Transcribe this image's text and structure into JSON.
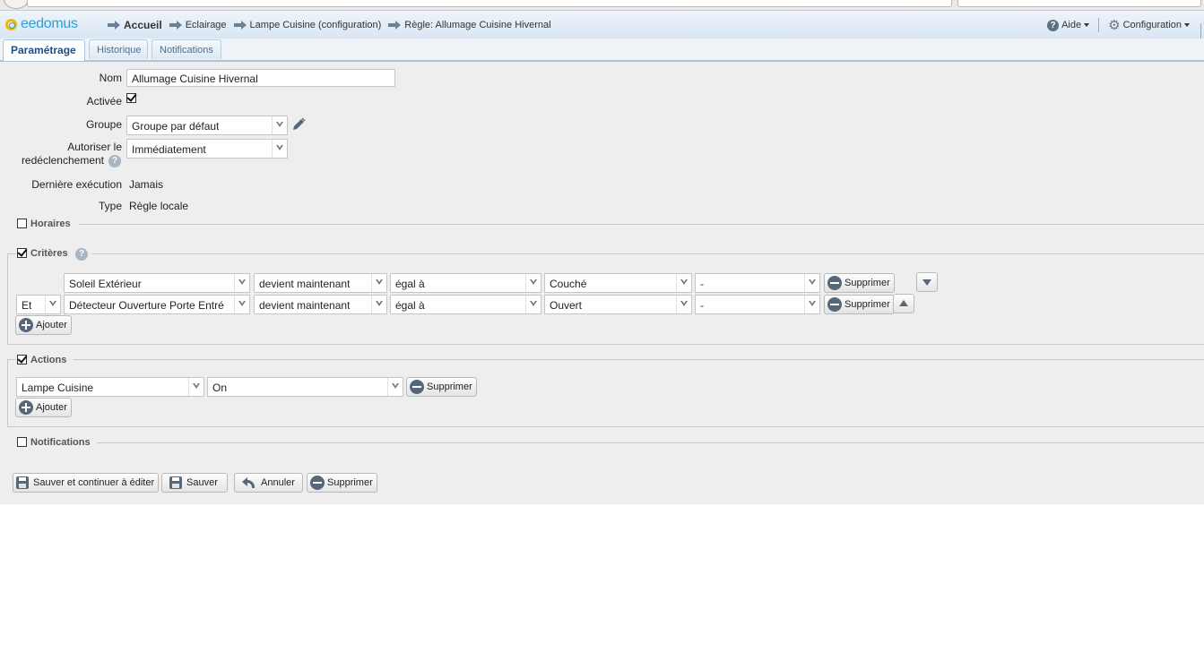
{
  "app": {
    "logo_text": "eedomus"
  },
  "breadcrumb": [
    "Accueil",
    "Eclairage",
    "Lampe Cuisine (configuration)",
    "Règle: Allumage Cuisine Hivernal"
  ],
  "topbar": {
    "help_label": "Aide",
    "config_label": "Configuration"
  },
  "tabs": [
    {
      "label": "Paramétrage",
      "active": true
    },
    {
      "label": "Historique",
      "active": false
    },
    {
      "label": "Notifications",
      "active": false
    }
  ],
  "form": {
    "name_label": "Nom",
    "name_value": "Allumage Cuisine Hivernal",
    "active_label": "Activée",
    "active_checked": true,
    "group_label": "Groupe",
    "group_value": "Groupe par défaut",
    "retrigger_label_1": "Autoriser le",
    "retrigger_label_2": "redéclenchement",
    "retrigger_value": "Immédiatement",
    "last_exec_label": "Dernière exécution",
    "last_exec_value": "Jamais",
    "type_label": "Type",
    "type_value": "Règle locale"
  },
  "sections": {
    "schedules": {
      "title": "Horaires",
      "checked": false
    },
    "criteria": {
      "title": "Critères",
      "checked": true
    },
    "actions": {
      "title": "Actions",
      "checked": true
    },
    "notifications": {
      "title": "Notifications",
      "checked": false
    }
  },
  "criteria_rows": [
    {
      "connector": "",
      "device": "Soleil Extérieur",
      "change": "devient maintenant",
      "operator": "égal à",
      "value": "Couché",
      "extra": "-",
      "delete_label": "Supprimer",
      "move": "down"
    },
    {
      "connector": "Et",
      "device": "Détecteur Ouverture Porte Entré",
      "change": "devient maintenant",
      "operator": "égal à",
      "value": "Ouvert",
      "extra": "-",
      "delete_label": "Supprimer",
      "move": "up"
    }
  ],
  "criteria_add_label": "Ajouter",
  "action_rows": [
    {
      "device": "Lampe Cuisine",
      "value": "On",
      "delete_label": "Supprimer"
    }
  ],
  "actions_add_label": "Ajouter",
  "footer_buttons": {
    "save_continue": "Sauver et continuer à éditer",
    "save": "Sauver",
    "cancel": "Annuler",
    "delete": "Supprimer"
  },
  "colors": {
    "brand_blue": "#2a9fd8",
    "brand_yellow": "#f2b705",
    "tab_text": "#1d4f85",
    "panel_bg": "#eeeeee"
  }
}
